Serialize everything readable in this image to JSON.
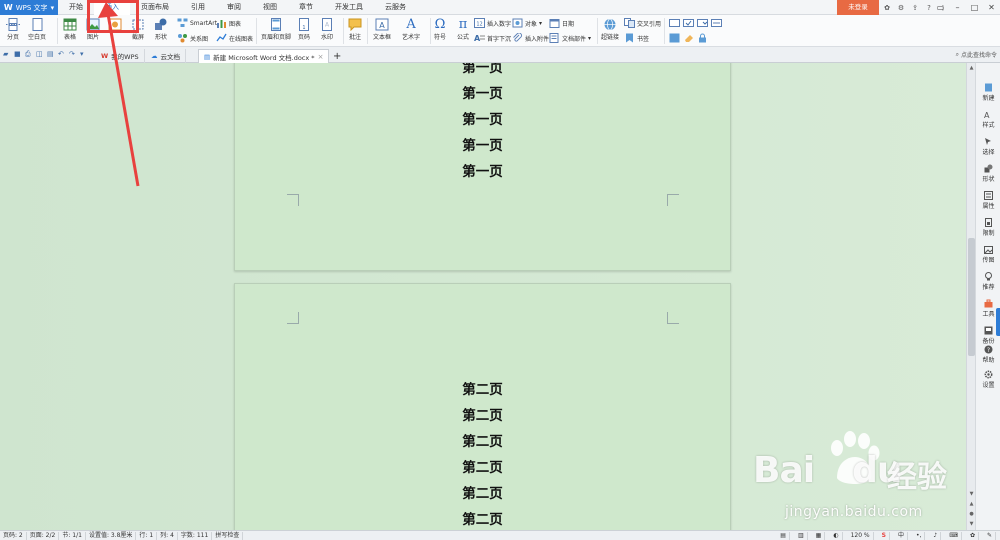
{
  "titlebar": {
    "app_name": "WPS 文字",
    "menu": [
      "开始",
      "插入",
      "页面布局",
      "引用",
      "审阅",
      "视图",
      "章节",
      "开发工具",
      "云服务"
    ],
    "active_menu_index": 1,
    "login_label": "未登录"
  },
  "ribbon": {
    "page_break": "分页",
    "blank_page": "空白页",
    "table": "表格",
    "picture": "图片",
    "screenshot": "截屏",
    "shape": "形状",
    "smartart": "SmartArt",
    "chart": "图表",
    "relation_graph": "关系图",
    "online_chart": "在线图表",
    "header_footer": "页眉和页脚",
    "page_number": "页码",
    "watermark": "水印",
    "comment": "批注",
    "textbox": "文本框",
    "wordart": "艺术字",
    "symbol": "符号",
    "formula": "公式",
    "insert_number": "插入数字",
    "object": "对象",
    "date": "日期",
    "drop_cap": "首字下沉",
    "attachment": "插入附件",
    "document_parts": "文档部件",
    "hyperlink": "超链接",
    "cross_reference": "交叉引用",
    "bookmark": "书签"
  },
  "tabs": {
    "items": [
      "我的WPS",
      "云文档",
      "新建 Microsoft Word 文档.docx *"
    ],
    "active_index": 2,
    "command_search": "点此查找命令"
  },
  "document": {
    "page1_lines": [
      "第一页",
      "第一页",
      "第一页",
      "第一页",
      "第一页"
    ],
    "page2_lines": [
      "第二页",
      "第二页",
      "第二页",
      "第二页",
      "第二页",
      "第二页"
    ]
  },
  "sidebar": {
    "items": [
      "新建",
      "样式",
      "选择",
      "形状",
      "属性",
      "限制",
      "传图",
      "推荐",
      "工具",
      "备份",
      "帮助",
      "设置"
    ]
  },
  "statusbar": {
    "items": [
      "页码: 2",
      "页面: 2/2",
      "节: 1/1",
      "设置值: 3.8厘米",
      "行: 1",
      "列: 4",
      "字数: 111",
      "拼写检查"
    ],
    "zoom": "120 %",
    "ime": "中"
  },
  "watermark": {
    "logo": "Bai",
    "logo2": "du",
    "cn": "经验",
    "url": "jingyan.baidu.com"
  },
  "colors": {
    "accent": "#2d7cd6",
    "login": "#e86a43",
    "annotation": "#e8413e",
    "doc_bg": "#cfe8cc"
  }
}
